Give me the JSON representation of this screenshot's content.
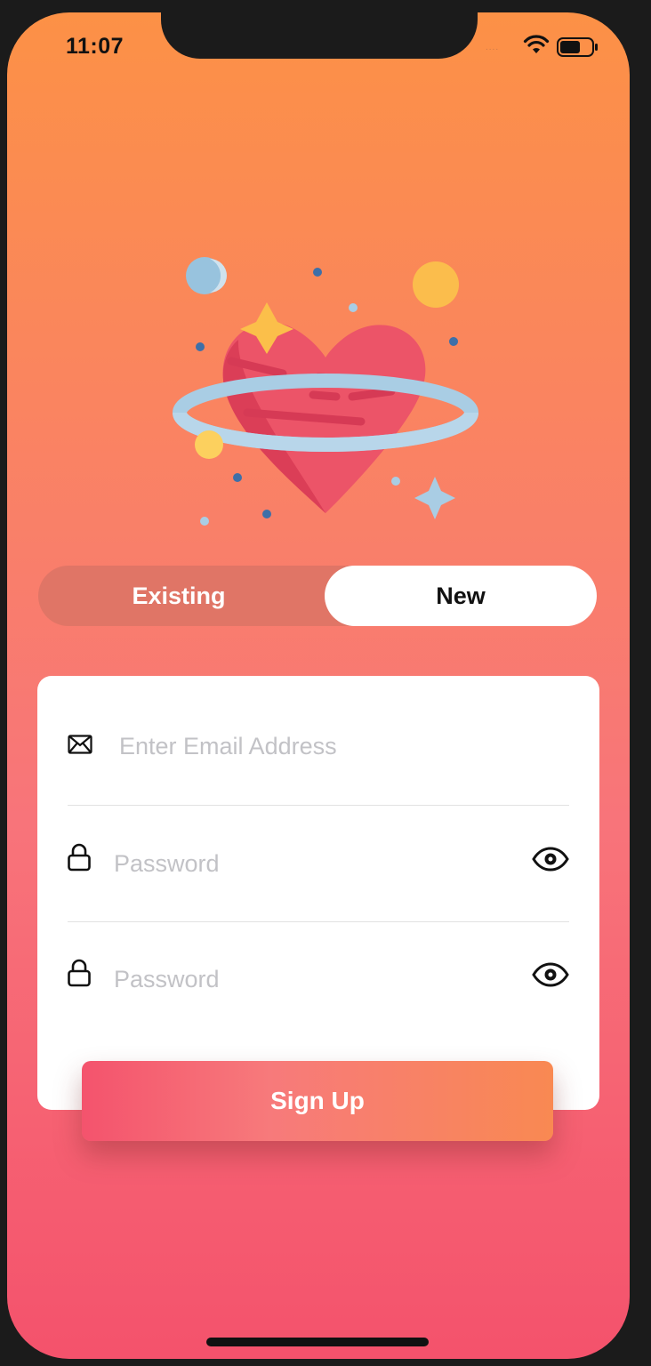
{
  "status_bar": {
    "time": "11:07",
    "signal": "....",
    "icons": [
      "wifi-icon",
      "battery-icon"
    ]
  },
  "illustration": {
    "icon": "heart-planet-illustration",
    "colors": {
      "heart": "#ec5468",
      "ring": "#a9cde4",
      "star": "#fbbf4a",
      "dot": "#3e6fa8"
    }
  },
  "segmented_control": {
    "options": [
      "Existing",
      "New"
    ],
    "selected": "New"
  },
  "form": {
    "email": {
      "placeholder": "Enter Email Address",
      "value": "",
      "icon": "envelope-icon"
    },
    "password": {
      "placeholder": "Password",
      "value": "",
      "icon": "lock-icon",
      "toggle_icon": "eye-icon"
    },
    "confirm_password": {
      "placeholder": "Password",
      "value": "",
      "icon": "lock-icon",
      "toggle_icon": "eye-icon"
    }
  },
  "signup_button": {
    "label": "Sign Up"
  },
  "colors": {
    "gradient_top": "#fc9146",
    "gradient_bottom": "#f4526c",
    "button_start": "#f4536d",
    "button_end": "#f98952"
  }
}
